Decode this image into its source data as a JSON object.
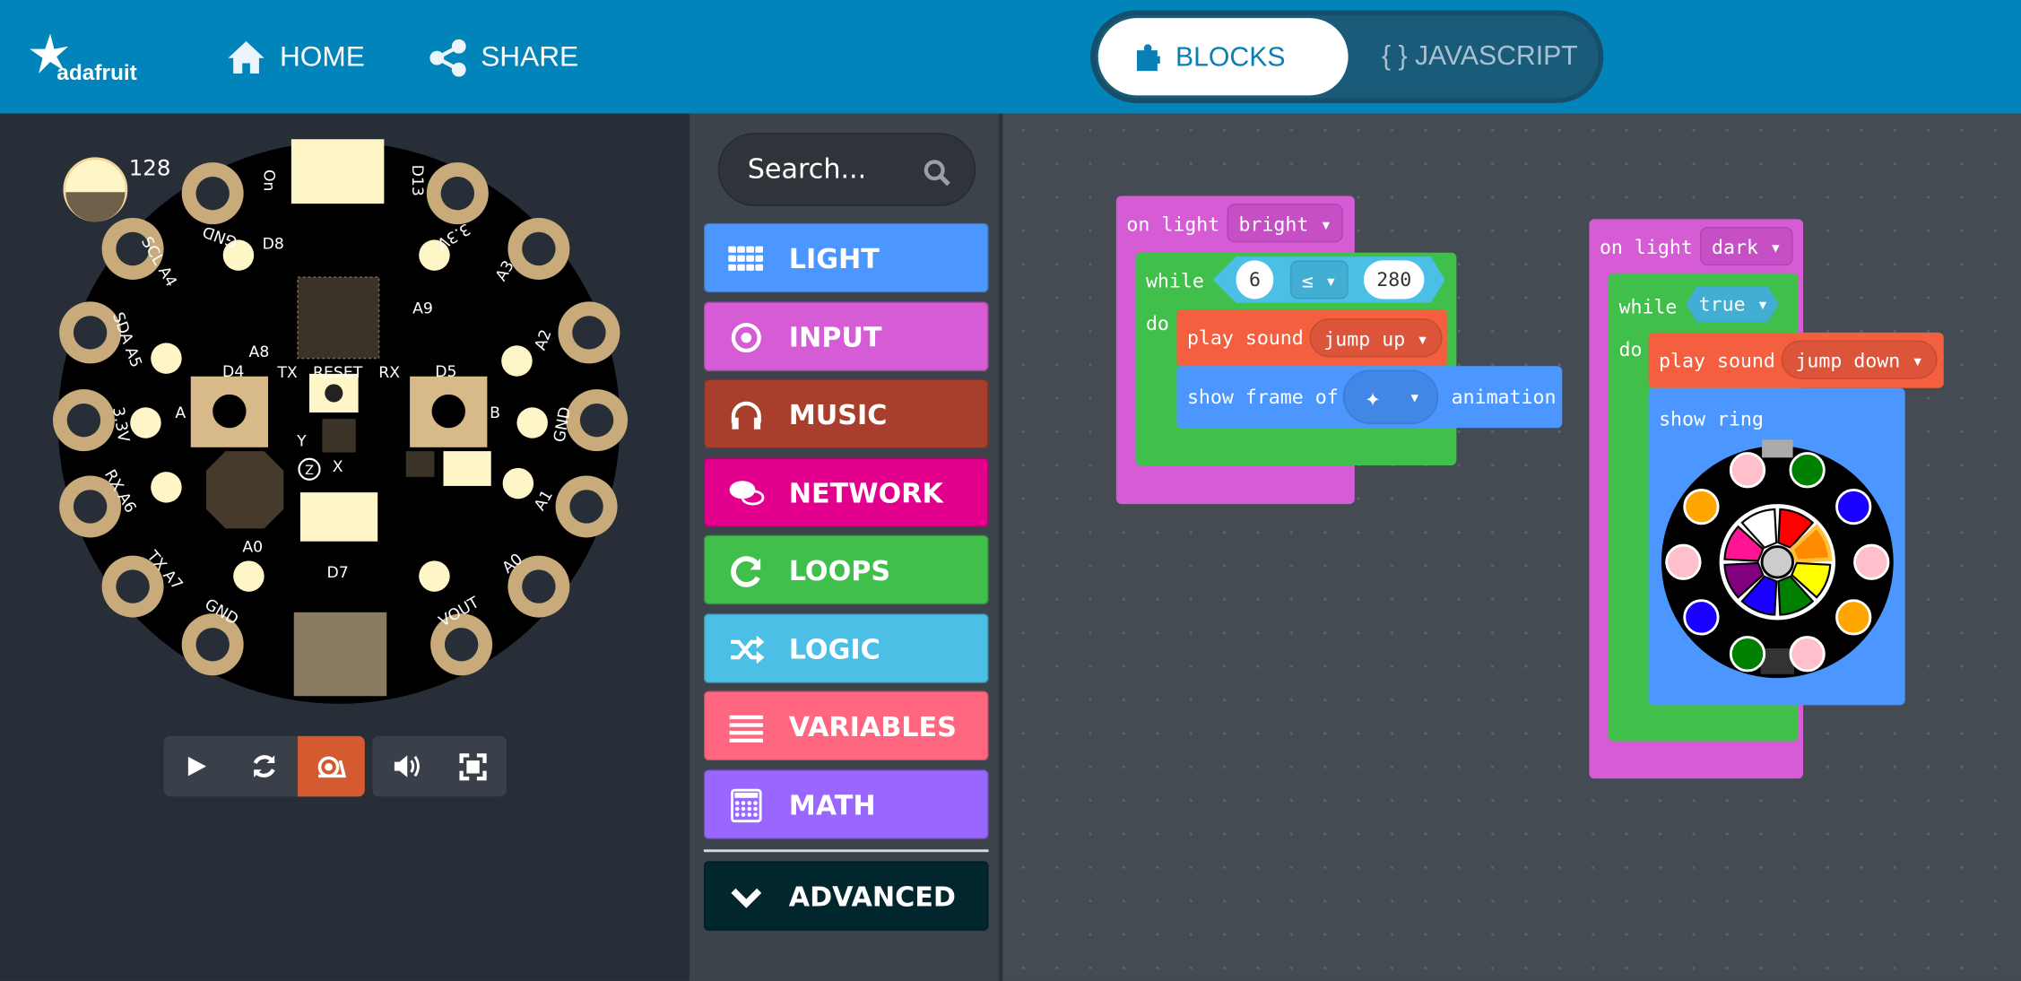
{
  "header": {
    "logo": "adafruit",
    "home": "HOME",
    "share": "SHARE",
    "blocks": "BLOCKS",
    "javascript": "{ } JAVASCRIPT",
    "colors": {
      "bar": "#0084b9",
      "active": "#0a7fb6"
    }
  },
  "simulator": {
    "light_level": "128",
    "board_labels": {
      "on": "On",
      "d13": "D13",
      "gnd_tl": "GND",
      "v33_tr": "3.3V",
      "d8": "D8",
      "scl": "SCL A4",
      "a3": "A3",
      "sda": "SDA A5",
      "a9": "A9",
      "a8": "A8",
      "a2": "A2",
      "d4": "D4",
      "tx": "TX",
      "reset": "RESET",
      "rx": "RX",
      "d5": "D5",
      "btn_a": "A",
      "btn_b": "B",
      "v33_l": "3.3V",
      "gnd_r": "GND",
      "rx_a6": "RX A6",
      "a1": "A1",
      "a0_l": "A0",
      "tx_a7": "TX A7",
      "d7": "D7",
      "gnd_b": "GND",
      "vout": "VOUT",
      "a0_r": "A0",
      "y": "Y",
      "z": "Z",
      "x": "X"
    },
    "controls": [
      "play-icon",
      "restart-icon",
      "slow-mo-snail-icon",
      "sound-icon",
      "fullscreen-icon"
    ],
    "slowmo_color": "#d45a2f"
  },
  "toolbox": {
    "search_placeholder": "Search...",
    "categories": [
      {
        "label": "LIGHT",
        "icon": "grid-icon",
        "color": "#4c97ff"
      },
      {
        "label": "INPUT",
        "icon": "target-icon",
        "color": "#d65cd6"
      },
      {
        "label": "MUSIC",
        "icon": "headphones-icon",
        "color": "#a83f2c"
      },
      {
        "label": "NETWORK",
        "icon": "chat-icon",
        "color": "#e3008c"
      },
      {
        "label": "LOOPS",
        "icon": "refresh-icon",
        "color": "#40bf4a"
      },
      {
        "label": "LOGIC",
        "icon": "shuffle-icon",
        "color": "#4cbfe6"
      },
      {
        "label": "VARIABLES",
        "icon": "list-icon",
        "color": "#ff6680"
      },
      {
        "label": "MATH",
        "icon": "calculator-icon",
        "color": "#9966ff"
      }
    ],
    "advanced": {
      "label": "ADVANCED",
      "icon": "chevron-down-icon",
      "color": "#01262d"
    }
  },
  "workspace": {
    "block1": {
      "event": "on light",
      "event_value": "bright",
      "loop": "while",
      "left": "6",
      "op": "≤",
      "right": "280",
      "do": "do",
      "sound_label": "play sound",
      "sound": "jump up",
      "frame_pre": "show frame of",
      "frame_post": "animation"
    },
    "block2": {
      "event": "on light",
      "event_value": "dark",
      "loop": "while",
      "cond": "true",
      "do": "do",
      "sound_label": "play sound",
      "sound": "jump down",
      "ring_label": "show ring",
      "outer_leds": [
        "#008000",
        "#1a00ff",
        "#ffc0cb",
        "#ffa500",
        "#ffc0cb",
        "#008000",
        "#1a00ff",
        "#ffc0cb",
        "#ffa500",
        "#ffc0cb"
      ],
      "palette": [
        "#ff0000",
        "#ff8c00",
        "#ffff00",
        "#008000",
        "#1a00ff",
        "#800080",
        "#ff1493",
        "#ffffff"
      ],
      "selected_color": "#ff8c00"
    }
  }
}
